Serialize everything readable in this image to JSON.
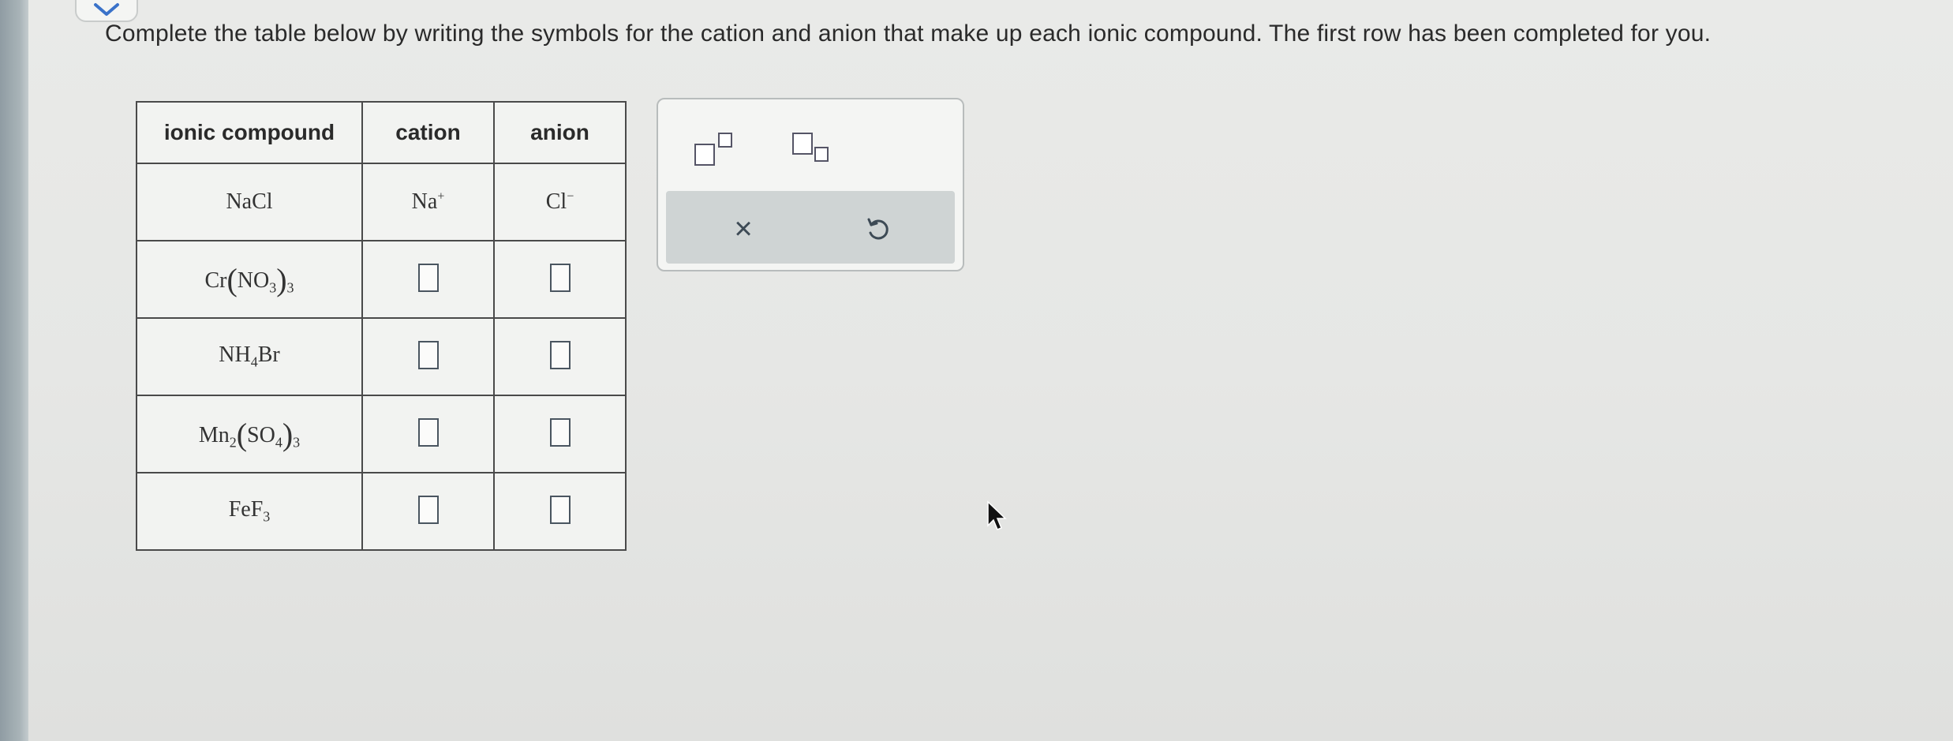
{
  "instructions": "Complete the table below by writing the symbols for the cation and anion that make up each ionic compound. The first row has been completed for you.",
  "table": {
    "headers": {
      "compound": "ionic compound",
      "cation": "cation",
      "anion": "anion"
    },
    "rows": [
      {
        "compound": {
          "p1": "NaCl"
        },
        "cation": {
          "symbol": "Na",
          "charge": "+"
        },
        "anion": {
          "symbol": "Cl",
          "charge": "−"
        }
      },
      {
        "compound": {
          "a": "Cr",
          "b": "NO",
          "c": "3",
          "d": "3"
        }
      },
      {
        "compound": {
          "a": "NH",
          "b": "4",
          "c": "Br"
        }
      },
      {
        "compound": {
          "a": "Mn",
          "b": "2",
          "c": "SO",
          "d": "4",
          "e": "3"
        }
      },
      {
        "compound": {
          "a": "FeF",
          "b": "3"
        }
      }
    ]
  },
  "toolbox": {
    "superscript_tool": "superscript-icon",
    "subscript_tool": "subscript-icon",
    "clear_icon": "×",
    "undo_icon": "undo-icon"
  }
}
